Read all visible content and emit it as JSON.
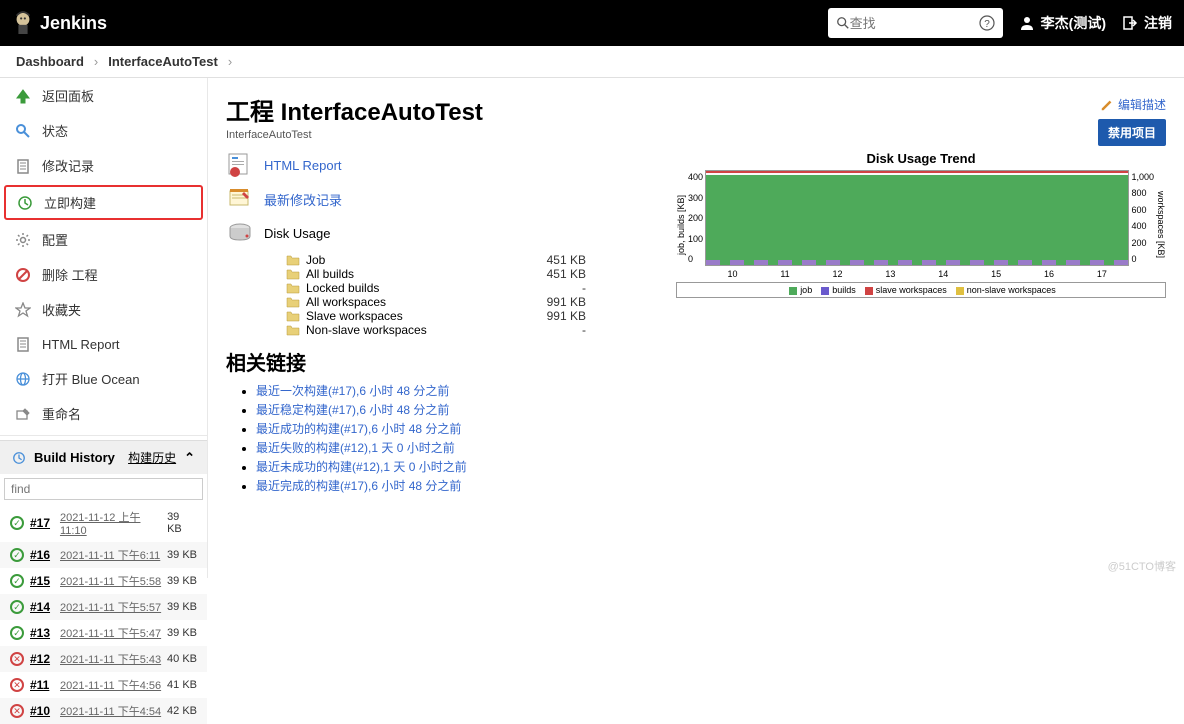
{
  "header": {
    "brand": "Jenkins",
    "search_placeholder": "查找",
    "user": "李杰(测试)",
    "logout": "注销"
  },
  "breadcrumb": {
    "dashboard": "Dashboard",
    "project": "InterfaceAutoTest"
  },
  "sidebar": {
    "items": [
      {
        "icon": "arrow-up",
        "label": "返回面板",
        "color": "#3b9b3b"
      },
      {
        "icon": "magnify",
        "label": "状态",
        "color": "#4a90d9"
      },
      {
        "icon": "doc",
        "label": "修改记录",
        "color": "#888"
      },
      {
        "icon": "clock",
        "label": "立即构建",
        "color": "#3b9b3b",
        "highlighted": true
      },
      {
        "icon": "gear",
        "label": "配置",
        "color": "#888"
      },
      {
        "icon": "no",
        "label": "删除 工程",
        "color": "#d04343"
      },
      {
        "icon": "star",
        "label": "收藏夹",
        "color": "#888"
      },
      {
        "icon": "doc",
        "label": "HTML Report",
        "color": "#888"
      },
      {
        "icon": "globe",
        "label": "打开 Blue Ocean",
        "color": "#4a90d9"
      },
      {
        "icon": "rename",
        "label": "重命名",
        "color": "#888"
      }
    ],
    "history_title": "Build History",
    "history_link": "构建历史",
    "find_placeholder": "find",
    "builds": [
      {
        "status": "ok",
        "num": "#17",
        "date": "2021-11-12 上午11:10",
        "size": "39 KB"
      },
      {
        "status": "ok",
        "num": "#16",
        "date": "2021-11-11 下午6:11",
        "size": "39 KB"
      },
      {
        "status": "ok",
        "num": "#15",
        "date": "2021-11-11 下午5:58",
        "size": "39 KB"
      },
      {
        "status": "ok",
        "num": "#14",
        "date": "2021-11-11 下午5:57",
        "size": "39 KB"
      },
      {
        "status": "ok",
        "num": "#13",
        "date": "2021-11-11 下午5:47",
        "size": "39 KB"
      },
      {
        "status": "fail",
        "num": "#12",
        "date": "2021-11-11 下午5:43",
        "size": "40 KB"
      },
      {
        "status": "fail",
        "num": "#11",
        "date": "2021-11-11 下午4:56",
        "size": "41 KB"
      },
      {
        "status": "fail",
        "num": "#10",
        "date": "2021-11-11 下午4:54",
        "size": "42 KB"
      }
    ]
  },
  "content": {
    "title": "工程 InterfaceAutoTest",
    "subtitle": "InterfaceAutoTest",
    "edit_desc": "编辑描述",
    "disable": "禁用项目",
    "html_report": "HTML Report",
    "recent_changes": "最新修改记录",
    "disk_usage_label": "Disk Usage",
    "disk_rows": [
      {
        "label": "Job",
        "val": "451 KB"
      },
      {
        "label": "All builds",
        "val": "451 KB"
      },
      {
        "label": "Locked builds",
        "val": "-"
      },
      {
        "label": "All workspaces",
        "val": "991 KB"
      },
      {
        "label": "Slave workspaces",
        "val": "991 KB"
      },
      {
        "label": "Non-slave workspaces",
        "val": "-"
      }
    ],
    "related_title": "相关链接",
    "related_links": [
      "最近一次构建(#17),6 小时 48 分之前",
      "最近稳定构建(#17),6 小时 48 分之前",
      "最近成功的构建(#17),6 小时 48 分之前",
      "最近失败的构建(#12),1 天 0 小时之前",
      "最近未成功的构建(#12),1 天 0 小时之前",
      "最近完成的构建(#17),6 小时 48 分之前"
    ]
  },
  "chart_data": {
    "type": "area",
    "title": "Disk Usage Trend",
    "x": [
      "10",
      "11",
      "12",
      "13",
      "14",
      "15",
      "16",
      "17"
    ],
    "y_left_label": "job, builds [KB]",
    "y_right_label": "workspaces [KB]",
    "y_left_ticks": [
      "400",
      "300",
      "200",
      "100",
      "0"
    ],
    "y_right_ticks": [
      "1,000",
      "800",
      "600",
      "400",
      "200",
      "0"
    ],
    "series": [
      {
        "name": "job",
        "color": "#4eaa5a",
        "values": [
          451,
          451,
          451,
          451,
          451,
          451,
          451,
          451
        ]
      },
      {
        "name": "builds",
        "color": "#6a5acd",
        "values": [
          40,
          40,
          38,
          38,
          38,
          38,
          40,
          38
        ]
      },
      {
        "name": "slave workspaces",
        "color": "#d04343",
        "values": [
          991,
          991,
          991,
          991,
          991,
          991,
          991,
          991
        ]
      },
      {
        "name": "non-slave workspaces",
        "color": "#e0c040",
        "values": [
          0,
          0,
          0,
          0,
          0,
          0,
          0,
          0
        ]
      }
    ],
    "legend": [
      "job",
      "builds",
      "slave workspaces",
      "non-slave workspaces"
    ]
  },
  "watermark": "@51CTO博客"
}
